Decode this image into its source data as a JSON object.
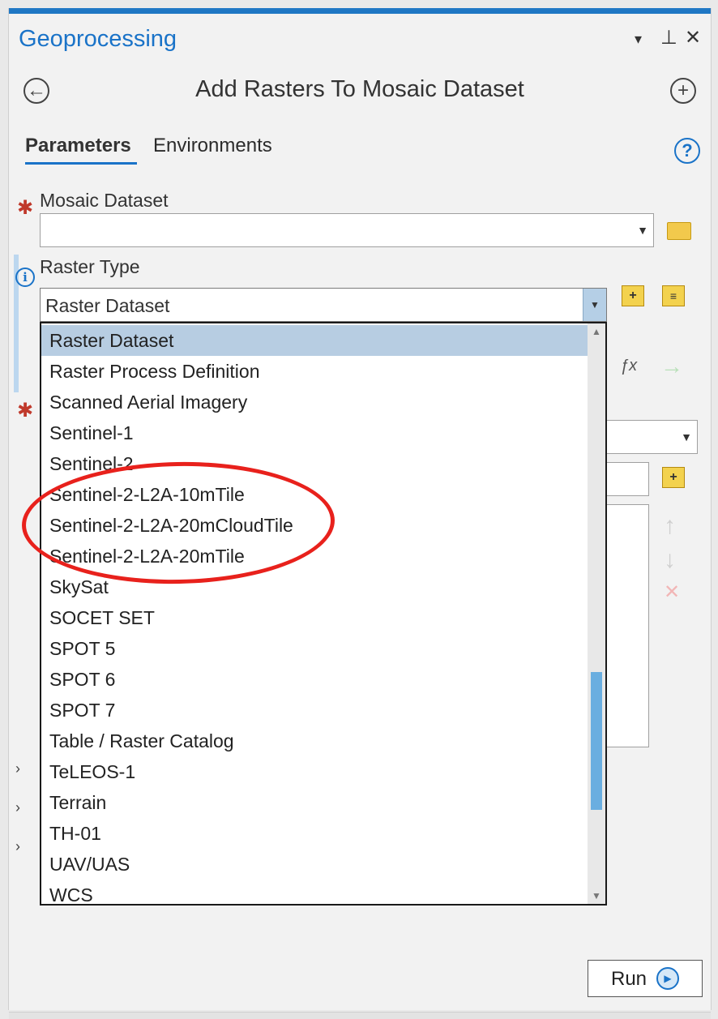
{
  "pane": {
    "title": "Geoprocessing",
    "controls": {
      "menu": "▾",
      "pin": "⊥",
      "close": "✕"
    },
    "tool_title": "Add Rasters To Mosaic Dataset",
    "tabs": [
      {
        "label": "Parameters",
        "active": true
      },
      {
        "label": "Environments",
        "active": false
      }
    ],
    "help_glyph": "?"
  },
  "params": {
    "mosaic_dataset": {
      "label": "Mosaic Dataset",
      "value": ""
    },
    "raster_type": {
      "label": "Raster Type",
      "value": "Raster Dataset"
    }
  },
  "dropdown": {
    "options": [
      "Raster Dataset",
      "Raster Process Definition",
      "Scanned Aerial Imagery",
      "Sentinel-1",
      "Sentinel-2",
      "Sentinel-2-L2A-10mTile",
      "Sentinel-2-L2A-20mCloudTile",
      "Sentinel-2-L2A-20mTile",
      "SkySat",
      "SOCET SET",
      "SPOT 5",
      "SPOT 6",
      "SPOT 7",
      "Table / Raster Catalog",
      "TeLEOS-1",
      "Terrain",
      "TH-01",
      "UAV/UAS",
      "WCS"
    ],
    "selected": "Raster Dataset",
    "highlighted_options": [
      "Sentinel-2-L2A-10mTile",
      "Sentinel-2-L2A-20mCloudTile",
      "Sentinel-2-L2A-20mTile"
    ]
  },
  "run_button": {
    "label": "Run"
  },
  "colors": {
    "accent": "#1a73c8",
    "annotation": "#e8211c",
    "selection": "#b7cde2"
  },
  "icons": [
    "back-icon",
    "add-icon",
    "help-icon",
    "info-icon",
    "folder-icon",
    "add-raster-type-icon",
    "properties-icon",
    "function-icon",
    "arrow-right-icon",
    "move-up-icon",
    "move-down-icon",
    "remove-icon",
    "run-icon"
  ]
}
